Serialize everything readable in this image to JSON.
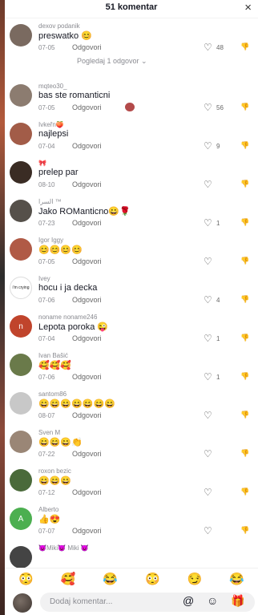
{
  "header": {
    "title": "51 komentar",
    "close_label": "×"
  },
  "comments": [
    {
      "user": "dexov podanik",
      "text": "preswatko 😊",
      "date": "07-05",
      "reply": "Odgovori",
      "likes": "48",
      "avatar_letter": "",
      "avatar_color": "#7a6a60",
      "view_replies": "Pogledaj 1 odgovor ⌄"
    },
    {
      "user": "mqteo30_",
      "text": "bas ste romanticni",
      "date": "07-05",
      "reply": "Odgovori",
      "likes": "56",
      "avatar_letter": "",
      "avatar_color": "#8c7c70"
    },
    {
      "user": "Ivkeřn🍑",
      "text": "najlepsi",
      "date": "07-04",
      "reply": "Odgovori",
      "likes": "9",
      "avatar_letter": "",
      "avatar_color": "#a25c48"
    },
    {
      "user": "🎀",
      "text": "prelep par",
      "date": "08-10",
      "reply": "Odgovori",
      "likes": "",
      "avatar_letter": "",
      "avatar_color": "#3a2c24"
    },
    {
      "user": "السرا ™",
      "text": "Jako ROManticno😀🌹",
      "date": "07-23",
      "reply": "Odgovori",
      "likes": "1",
      "avatar_letter": "",
      "avatar_color": "#55504a"
    },
    {
      "user": "Igor Iggy",
      "text": "😊😊😊😊",
      "date": "07-05",
      "reply": "Odgovori",
      "likes": "",
      "avatar_letter": "",
      "avatar_color": "#b05a46"
    },
    {
      "user": "Ivey",
      "text": "hocu i ja decka",
      "date": "07-06",
      "reply": "Odgovori",
      "likes": "4",
      "avatar_letter": "i'm crying",
      "avatar_color": "#ffffff"
    },
    {
      "user": "noname noname246",
      "text": "Lepota poroka 😜",
      "date": "07-04",
      "reply": "Odgovori",
      "likes": "1",
      "avatar_letter": "n",
      "avatar_color": "#c0442c"
    },
    {
      "user": "Ivan Bašić",
      "text": "🥰🥰🥰",
      "date": "07-06",
      "reply": "Odgovori",
      "likes": "1",
      "avatar_letter": "",
      "avatar_color": "#6a7a4a"
    },
    {
      "user": "santom86",
      "text": "😄😄😄😄😄😄😄",
      "date": "08-07",
      "reply": "Odgovori",
      "likes": "",
      "avatar_letter": "",
      "avatar_color": "#c8c8c8"
    },
    {
      "user": "Sven M",
      "text": "😄😄😄👏",
      "date": "07-22",
      "reply": "Odgovori",
      "likes": "",
      "avatar_letter": "",
      "avatar_color": "#9a8676"
    },
    {
      "user": "roxon bezic",
      "text": "😄😄😄",
      "date": "07-12",
      "reply": "Odgovori",
      "likes": "",
      "avatar_letter": "",
      "avatar_color": "#4a6a3a"
    },
    {
      "user": "Alberto",
      "text": "👍😍",
      "date": "07-07",
      "reply": "Odgovori",
      "likes": "",
      "avatar_letter": "A",
      "avatar_color": "#4caf50"
    },
    {
      "user": "😈Miki😈 Miki 😈",
      "text": "",
      "date": "",
      "reply": "",
      "likes": "",
      "avatar_letter": "",
      "avatar_color": "#444444"
    }
  ],
  "emoji_bar": [
    "😳",
    "🥰",
    "😂",
    "😳",
    "😏",
    "😂"
  ],
  "input": {
    "placeholder": "Dodaj komentar...",
    "at_icon": "@",
    "emoji_icon": "☺",
    "gift_icon": "🎁"
  },
  "icons": {
    "heart": "♡",
    "dislike": "👎"
  }
}
